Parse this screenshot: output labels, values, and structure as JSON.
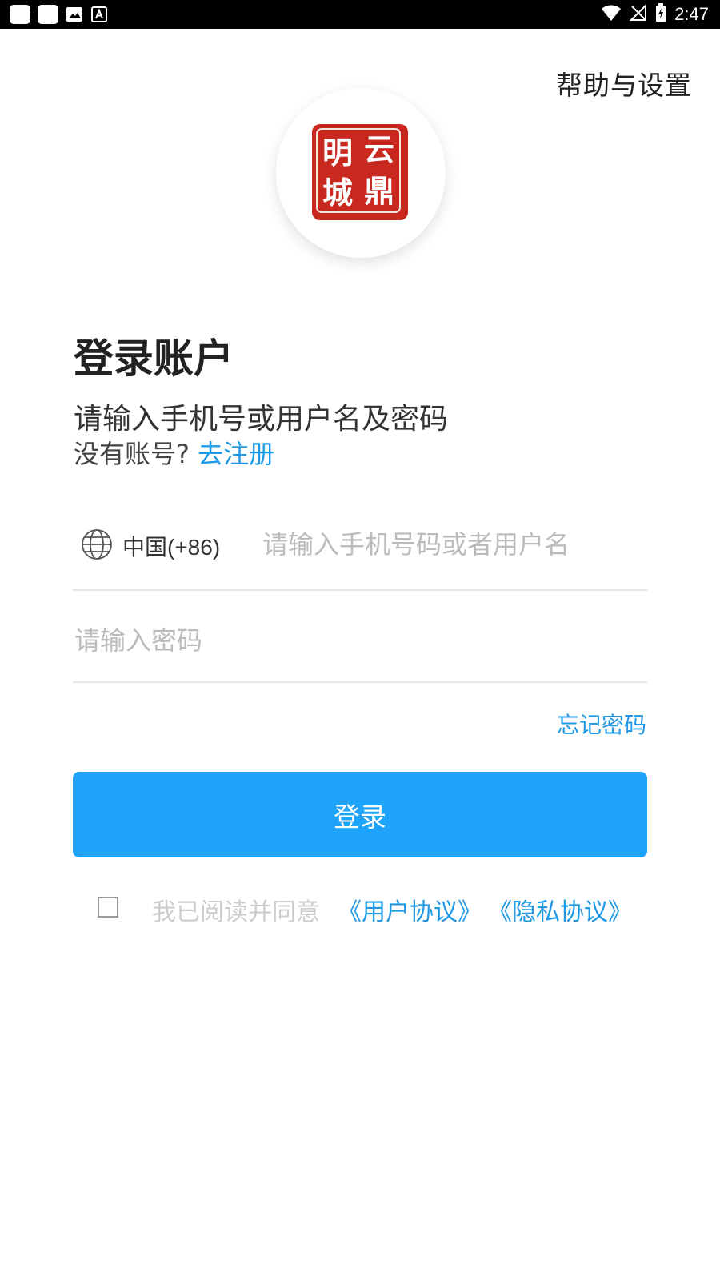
{
  "status_bar": {
    "time": "2:47",
    "icons": [
      "notification-icon",
      "notification-icon",
      "image-icon",
      "text-a-icon",
      "wifi-icon",
      "no-signal-icon",
      "battery-charging-icon"
    ]
  },
  "header": {
    "help_link": "帮助与设置"
  },
  "logo": {
    "chars": [
      "明",
      "云",
      "城",
      "鼎"
    ]
  },
  "login": {
    "title": "登录账户",
    "subtitle": "请输入手机号或用户名及密码",
    "no_account_text": "没有账号?",
    "register_link": "去注册",
    "country_code": "中国(+86)",
    "phone_placeholder": "请输入手机号码或者用户名",
    "password_placeholder": "请输入密码",
    "forgot_password": "忘记密码",
    "login_button": "登录",
    "agree_text": "我已阅读并同意",
    "user_agreement": "《用户协议》",
    "privacy_agreement": "《隐私协议》"
  },
  "colors": {
    "accent": "#1f99e6",
    "button": "#1ea3fb",
    "seal": "#c8281e"
  }
}
